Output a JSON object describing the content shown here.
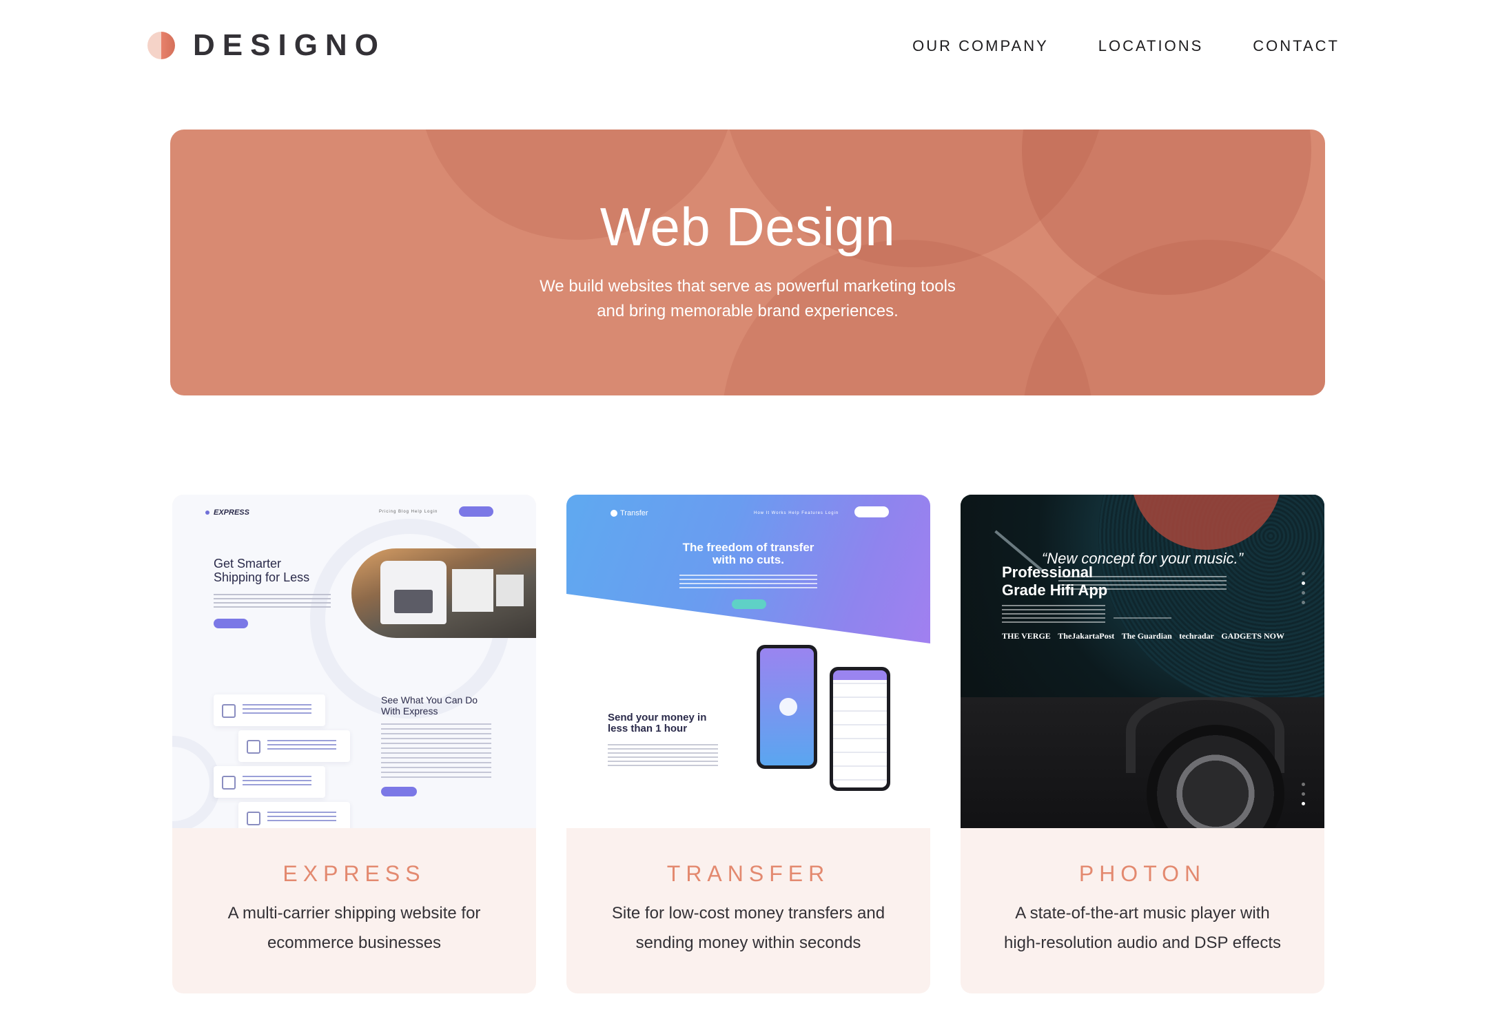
{
  "header": {
    "logo_text": "DESIGNO",
    "nav": [
      {
        "label": "OUR COMPANY"
      },
      {
        "label": "LOCATIONS"
      },
      {
        "label": "CONTACT"
      }
    ]
  },
  "hero": {
    "title": "Web Design",
    "subtitle_line1": "We build websites that serve as powerful marketing tools",
    "subtitle_line2": "and bring memorable brand experiences."
  },
  "projects": [
    {
      "title": "EXPRESS",
      "description": "A multi-carrier shipping website for ecommerce businesses",
      "thumbnail": {
        "brand": "EXPRESS",
        "nav": "Pricing   Blog   Help      Login",
        "headline": "Get Smarter Shipping for Less",
        "section_heading": "See What You Can Do With Express"
      }
    },
    {
      "title": "TRANSFER",
      "description": "Site for low-cost money transfers and sending money within seconds",
      "thumbnail": {
        "brand": "Transfer",
        "nav": "How It Works   Help   Features   Login",
        "headline": "The freedom of transfer with no cuts.",
        "section_heading": "Send your money in less than 1 hour"
      }
    },
    {
      "title": "PHOTON",
      "description": "A state-of-the-art music player with high-resolution audio and DSP effects",
      "thumbnail": {
        "headline": "“New concept for your music.”",
        "press": [
          "THE VERGE",
          "TheJakartaPost",
          "The Guardian",
          "techradar",
          "GADGETS NOW"
        ],
        "section_heading": "Professional Grade Hifi App"
      }
    }
  ],
  "colors": {
    "accent": "#e3896f",
    "hero_bg": "#d88a72",
    "card_bg": "#fbf1ee",
    "text_dark": "#333136"
  }
}
